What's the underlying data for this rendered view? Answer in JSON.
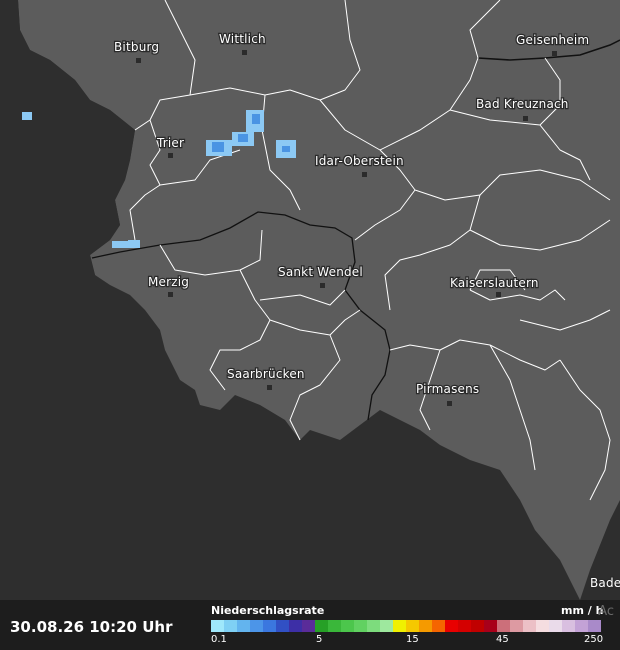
{
  "cities": [
    {
      "name": "Bitburg"
    },
    {
      "name": "Wittlich"
    },
    {
      "name": "Geisenheim"
    },
    {
      "name": "Bad Kreuznach"
    },
    {
      "name": "Trier"
    },
    {
      "name": "Idar-Oberstein"
    },
    {
      "name": "Sankt Wendel"
    },
    {
      "name": "Merzig"
    },
    {
      "name": "Kaiserslautern"
    },
    {
      "name": "Saarbrücken"
    },
    {
      "name": "Pirmasens"
    },
    {
      "name": "Bade"
    }
  ],
  "footer": {
    "timestamp": "30.08.26 10:20 Uhr",
    "legend_title": "Niederschlagsrate",
    "legend_unit": "mm / h",
    "ticks": [
      "0.1",
      "5",
      "15",
      "45",
      "250"
    ],
    "attribution": "Ac"
  },
  "legend_colors": [
    "#9fe8fb",
    "#7fd0f4",
    "#63b4ee",
    "#4c95e8",
    "#3b77df",
    "#3150c4",
    "#3d2fa6",
    "#5a2c99",
    "#26a026",
    "#3ab73a",
    "#4cc64c",
    "#61d161",
    "#7ddc7d",
    "#9ee89e",
    "#f0f000",
    "#f5c800",
    "#f59a00",
    "#f56500",
    "#e80000",
    "#d40000",
    "#c00000",
    "#a8001a",
    "#cc6f7a",
    "#dd9aa2",
    "#ecc0c6",
    "#f5dde0",
    "#eadbea",
    "#d9bfe0",
    "#c3a2d6",
    "#a98ac9"
  ],
  "colors": {
    "land": "#5c5c5c",
    "outside": "#2e2e2e",
    "rain_light": "#8cc9f4",
    "rain_medium": "#4a94e3"
  }
}
